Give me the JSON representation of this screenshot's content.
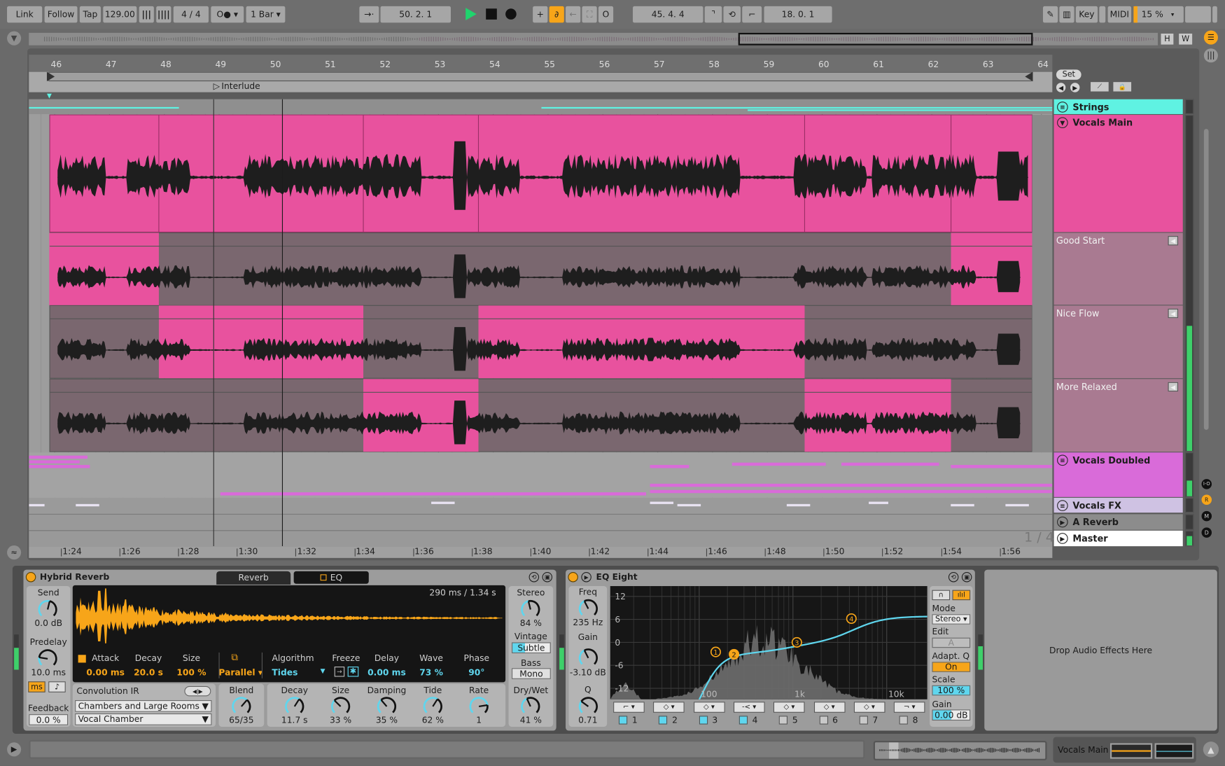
{
  "toolbar": {
    "link": "Link",
    "follow": "Follow",
    "tap": "Tap",
    "tempo": "129.00",
    "time_signature": "4 / 4",
    "metronome": "O●",
    "quantization": "1 Bar",
    "arrangement_position": "50.  2.  1",
    "loop_start": "45.  4.  4",
    "loop_length": "18.  0.  1",
    "key": "Key",
    "midi": "MIDI",
    "cpu_load": "15 %",
    "draw_mode_active": true,
    "automation_arm_active": true
  },
  "overview": {
    "h_label": "H",
    "w_label": "W"
  },
  "ruler": {
    "bars": [
      "46",
      "47",
      "48",
      "49",
      "50",
      "51",
      "52",
      "53",
      "54",
      "55",
      "56",
      "57",
      "58",
      "59",
      "60",
      "61",
      "62",
      "63",
      "64"
    ],
    "times": [
      "1:24",
      "1:26",
      "1:28",
      "1:30",
      "1:32",
      "1:34",
      "1:36",
      "1:38",
      "1:40",
      "1:42",
      "1:44",
      "1:46",
      "1:48",
      "1:50",
      "1:52",
      "1:54",
      "1:56"
    ],
    "locator": "Interlude",
    "zoom_ratio": "1 / 4",
    "playhead_bar": 50.1
  },
  "locators": {
    "set": "Set"
  },
  "tracks": [
    {
      "name": "Strings",
      "color": "#5ff2e2",
      "icon": "group-icon"
    },
    {
      "name": "Vocals Main",
      "color": "#e8529e",
      "icon": "fold-icon"
    },
    {
      "name": "Vocals Doubled",
      "color": "#d96bd9",
      "icon": "group-icon"
    },
    {
      "name": "Vocals FX",
      "color": "#cfc2e3",
      "icon": "group-icon"
    },
    {
      "name": "A Reverb",
      "color": "#8a8a8a",
      "icon": "play-icon"
    },
    {
      "name": "Master",
      "color": "#ffffff",
      "icon": "play-icon"
    }
  ],
  "take_lanes": [
    {
      "name": "Good Start",
      "selected_bars": [
        [
          45.9,
          47.9
        ],
        [
          62.35,
          63.83
        ]
      ]
    },
    {
      "name": "Nice Flow",
      "selected_bars": [
        [
          47.9,
          51.63
        ],
        [
          53.73,
          59.68
        ]
      ]
    },
    {
      "name": "More Relaxed",
      "selected_bars": [
        [
          51.63,
          53.73
        ],
        [
          59.68,
          62.35
        ]
      ]
    }
  ],
  "mixer_buttons": [
    "I-O",
    "R",
    "M",
    "D"
  ],
  "reverb": {
    "title": "Hybrid Reverb",
    "tabs": [
      "Reverb",
      "EQ"
    ],
    "send": {
      "label": "Send",
      "value": "0.0 dB",
      "level": 0.55
    },
    "predelay": {
      "label": "Predelay",
      "value": "10.0 ms",
      "level": 0.2
    },
    "ms": "ms",
    "note": "♪",
    "feedback": {
      "label": "Feedback",
      "value": "0.0 %"
    },
    "ir_time": "290 ms / 1.34 s",
    "params": [
      {
        "label": "Attack",
        "value": "0.00 ms",
        "color": "orange"
      },
      {
        "label": "Decay",
        "value": "20.0 s",
        "color": "orange"
      },
      {
        "label": "Size",
        "value": "100 %",
        "color": "orange"
      },
      {
        "label": "",
        "value": "Parallel ▾",
        "color": "orange"
      },
      {
        "label": "Algorithm",
        "value": "Tides",
        "color": "cyan"
      },
      {
        "label": "Freeze",
        "value": "",
        "color": "cyan"
      },
      {
        "label": "Delay",
        "value": "0.00 ms",
        "color": "cyan"
      },
      {
        "label": "Wave",
        "value": "73 %",
        "color": "cyan"
      },
      {
        "label": "Phase",
        "value": "90°",
        "color": "cyan"
      }
    ],
    "stereo": {
      "label": "Stereo",
      "value": "84 %",
      "level": 0.45
    },
    "vintage": {
      "label": "Vintage",
      "value": "Subtle",
      "level": 0.33
    },
    "bass": {
      "label": "Bass",
      "value": "Mono"
    },
    "convolution": {
      "label": "Convolution IR",
      "category": "Chambers and Large Rooms",
      "preset": "Vocal Chamber"
    },
    "blend": {
      "label": "Blend",
      "value": "65/35",
      "level": 0.65
    },
    "algo_knobs": [
      {
        "label": "Decay",
        "value": "11.7 s",
        "level": 0.62
      },
      {
        "label": "Size",
        "value": "33 %",
        "level": 0.33
      },
      {
        "label": "Damping",
        "value": "35 %",
        "level": 0.35
      },
      {
        "label": "Tide",
        "value": "62 %",
        "level": 0.62
      },
      {
        "label": "Rate",
        "value": "1",
        "level": 0.8
      }
    ],
    "drywet": {
      "label": "Dry/Wet",
      "value": "41 %",
      "level": 0.41
    }
  },
  "eq": {
    "title": "EQ Eight",
    "freq": {
      "label": "Freq",
      "value": "235 Hz",
      "level": 0.4
    },
    "gain": {
      "label": "Gain",
      "value": "-3.10 dB",
      "level": 0.4
    },
    "q": {
      "label": "Q",
      "value": "0.71",
      "level": 0.3
    },
    "y_ticks": [
      "12",
      "6",
      "0",
      "-6",
      "-12"
    ],
    "x_ticks": [
      "100",
      "1k",
      "10k"
    ],
    "bands": [
      {
        "num": "1",
        "on": true,
        "freq": 150,
        "gain": -2.5
      },
      {
        "num": "2",
        "on": true,
        "freq": 235,
        "gain": -3.1
      },
      {
        "num": "3",
        "on": true,
        "freq": 1100,
        "gain": 0
      },
      {
        "num": "4",
        "on": true,
        "freq": 4200,
        "gain": 6.2
      },
      {
        "num": "5",
        "on": false
      },
      {
        "num": "6",
        "on": false
      },
      {
        "num": "7",
        "on": false
      },
      {
        "num": "8",
        "on": false
      }
    ],
    "mode": {
      "label": "Mode",
      "value": "Stereo ▾"
    },
    "edit": {
      "label": "Edit",
      "value": "A"
    },
    "adaptq": {
      "label": "Adapt. Q",
      "value": "On"
    },
    "scale": {
      "label": "Scale",
      "value": "100 %",
      "level": 1.0
    },
    "out_gain": {
      "label": "Gain",
      "value": "0.00 dB"
    }
  },
  "drop_hint": "Drop Audio Effects Here",
  "status": {
    "selected_track": "Vocals Main"
  },
  "colors": {
    "accent": "#f7a519",
    "clip": "#e8529e",
    "take_inactive": "#7a676f",
    "cyan": "#5fd6ee"
  }
}
